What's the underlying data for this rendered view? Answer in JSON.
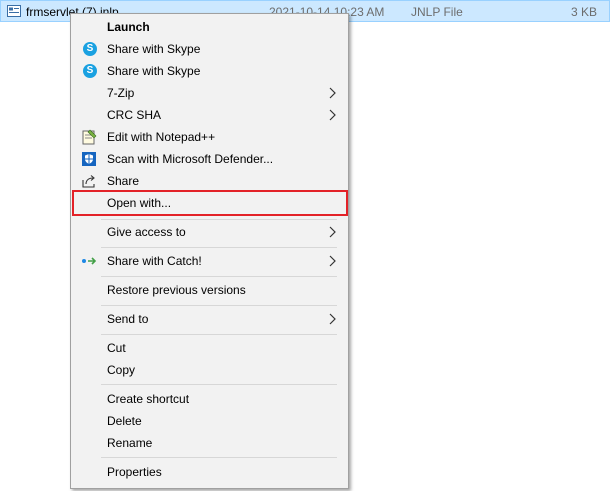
{
  "file": {
    "name": "frmservlet (7).jnlp",
    "date": "2021-10-14 10:23 AM",
    "type": "JNLP File",
    "size": "3 KB"
  },
  "menu": {
    "launch": "Launch",
    "share_skype_1": "Share with Skype",
    "share_skype_2": "Share with Skype",
    "zip": "7-Zip",
    "crc": "CRC SHA",
    "notepad": "Edit with Notepad++",
    "defender": "Scan with Microsoft Defender...",
    "share": "Share",
    "open_with": "Open with...",
    "give_access": "Give access to",
    "share_catch": "Share with Catch!",
    "restore": "Restore previous versions",
    "send_to": "Send to",
    "cut": "Cut",
    "copy": "Copy",
    "create_shortcut": "Create shortcut",
    "delete": "Delete",
    "rename": "Rename",
    "properties": "Properties"
  },
  "colors": {
    "selection": "#cce8ff",
    "highlight_border": "#e32228",
    "menu_bg": "#f2f2f2"
  }
}
